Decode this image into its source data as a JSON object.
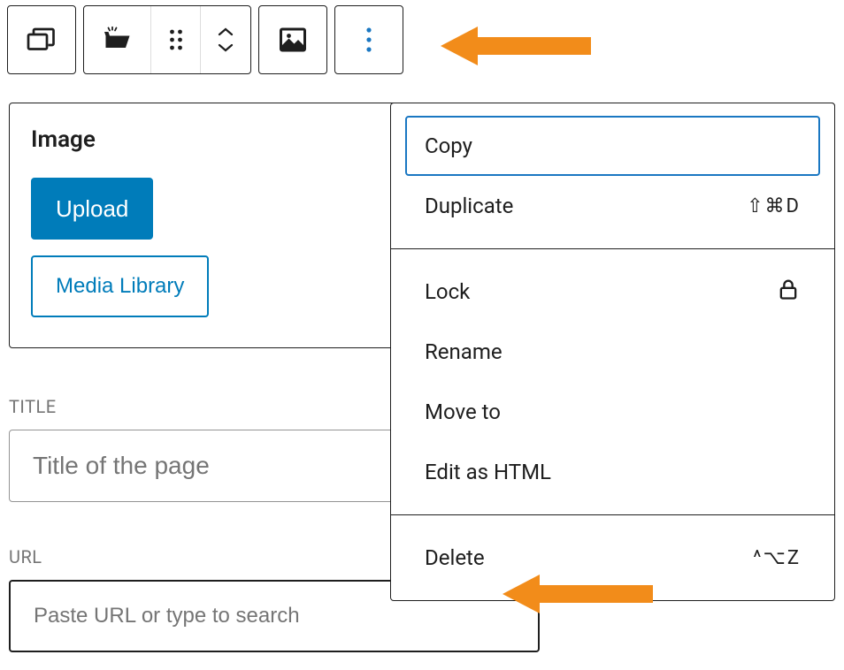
{
  "block": {
    "title": "Image",
    "upload_label": "Upload",
    "media_library_label": "Media Library"
  },
  "fields": {
    "title_label": "TITLE",
    "title_placeholder": "Title of the page",
    "url_label": "URL",
    "url_placeholder": "Paste URL or type to search"
  },
  "menu": {
    "copy": "Copy",
    "duplicate": {
      "label": "Duplicate",
      "shortcut": "⇧⌘D"
    },
    "lock": "Lock",
    "rename": "Rename",
    "move_to": "Move to",
    "edit_html": "Edit as HTML",
    "delete": {
      "label": "Delete",
      "shortcut": "^⌥Z"
    }
  },
  "colors": {
    "primary": "#007cba",
    "annotation": "#f28c1a"
  }
}
